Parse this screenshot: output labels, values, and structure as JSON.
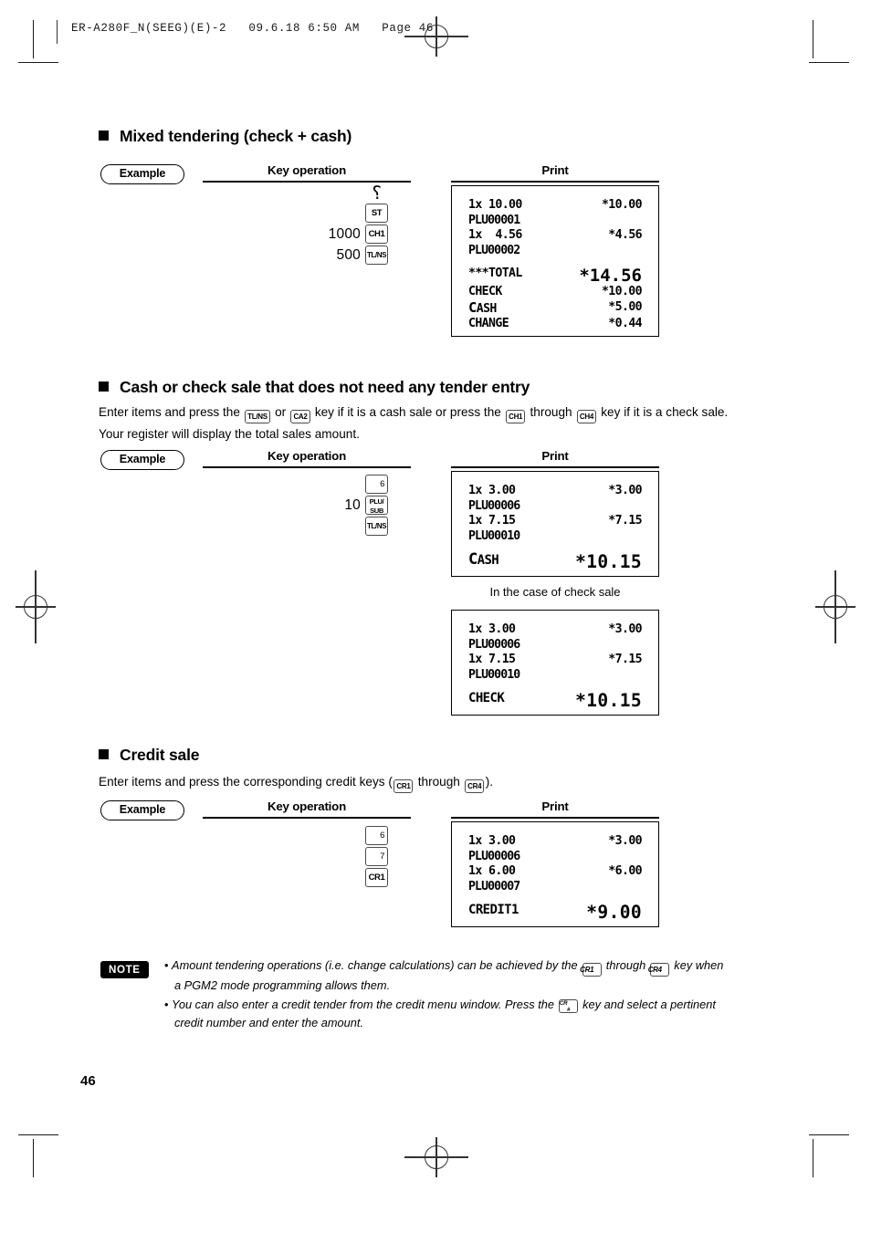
{
  "page": {
    "running_head": "ER-A280F_N(SEEG)(E)-2   09.6.18 6:50 AM   Page 46",
    "page_number": "46"
  },
  "sections": [
    {
      "id": "mixed-tendering",
      "title": "Mixed tendering (check + cash)",
      "example_label": "Example",
      "keyop_header": "Key operation",
      "print_header": "Print",
      "key_operation": {
        "squiggle": "⸮",
        "rows": [
          {
            "amount": "",
            "key": "ST",
            "key_type": "one"
          },
          {
            "amount": "1000",
            "key": "CH1",
            "key_type": "one"
          },
          {
            "amount": "500",
            "key": "TL/NS",
            "key_type": "one"
          }
        ]
      },
      "receipt": {
        "lines": [
          {
            "label": "1x 10.00",
            "value": "*10.00",
            "style": "item"
          },
          {
            "label": "PLU00001",
            "value": "",
            "style": "plu"
          },
          {
            "label": "1x  4.56",
            "value": "*4.56",
            "style": "item"
          },
          {
            "label": "PLU00002",
            "value": "",
            "style": "plu"
          },
          {
            "label": "",
            "value": "",
            "style": "gap"
          },
          {
            "label": "***TOTAL",
            "value": "*14.56",
            "style": "total"
          },
          {
            "label": "CHECK",
            "value": "*10.00",
            "style": "item"
          },
          {
            "label": "CASH",
            "value": "*5.00",
            "style": "item-bigC"
          },
          {
            "label": "CHANGE",
            "value": "*0.44",
            "style": "item"
          }
        ]
      }
    },
    {
      "id": "cash-or-check-no-tender",
      "title": "Cash or check sale that does not need any tender entry",
      "body_parts": [
        {
          "t": "text",
          "v": "Enter items and press the "
        },
        {
          "t": "key",
          "v": "TL/NS"
        },
        {
          "t": "text",
          "v": " or "
        },
        {
          "t": "key",
          "v": "CA2"
        },
        {
          "t": "text",
          "v": " key if it is a cash sale or press the "
        },
        {
          "t": "key",
          "v": "CH1"
        },
        {
          "t": "text",
          "v": " through "
        },
        {
          "t": "key",
          "v": "CH4"
        },
        {
          "t": "text",
          "v": " key if it is a check sale. Your register will display the total sales amount."
        }
      ],
      "example_label": "Example",
      "keyop_header": "Key operation",
      "print_header": "Print",
      "key_operation": {
        "squiggle": "",
        "rows": [
          {
            "amount": "",
            "key": "6",
            "key_type": "num"
          },
          {
            "amount": "10",
            "key": "PLU/SUB",
            "key_type": "two"
          },
          {
            "amount": "",
            "key": "TL/NS",
            "key_type": "one"
          }
        ]
      },
      "receipt": {
        "lines": [
          {
            "label": "1x 3.00",
            "value": "*3.00",
            "style": "item"
          },
          {
            "label": "PLU00006",
            "value": "",
            "style": "plu"
          },
          {
            "label": "1x 7.15",
            "value": "*7.15",
            "style": "item"
          },
          {
            "label": "PLU00010",
            "value": "",
            "style": "plu"
          },
          {
            "label": "",
            "value": "",
            "style": "gap"
          },
          {
            "label": "CASH",
            "value": "*10.15",
            "style": "big-bigC"
          }
        ]
      },
      "caption": "In the case of check sale",
      "receipt2": {
        "lines": [
          {
            "label": "1x 3.00",
            "value": "*3.00",
            "style": "item"
          },
          {
            "label": "PLU00006",
            "value": "",
            "style": "plu"
          },
          {
            "label": "1x 7.15",
            "value": "*7.15",
            "style": "item"
          },
          {
            "label": "PLU00010",
            "value": "",
            "style": "plu"
          },
          {
            "label": "",
            "value": "",
            "style": "gap"
          },
          {
            "label": "CHECK",
            "value": "*10.15",
            "style": "big"
          }
        ]
      }
    },
    {
      "id": "credit-sale",
      "title": "Credit sale",
      "body_parts": [
        {
          "t": "text",
          "v": "Enter items and press the corresponding credit keys ("
        },
        {
          "t": "key",
          "v": "CR1"
        },
        {
          "t": "text",
          "v": " through "
        },
        {
          "t": "key",
          "v": "CR4"
        },
        {
          "t": "text",
          "v": ")."
        }
      ],
      "example_label": "Example",
      "keyop_header": "Key operation",
      "print_header": "Print",
      "key_operation": {
        "squiggle": "",
        "rows": [
          {
            "amount": "",
            "key": "6",
            "key_type": "num"
          },
          {
            "amount": "",
            "key": "7",
            "key_type": "num"
          },
          {
            "amount": "",
            "key": "CR1",
            "key_type": "one"
          }
        ]
      },
      "receipt": {
        "lines": [
          {
            "label": "1x 3.00",
            "value": "*3.00",
            "style": "item"
          },
          {
            "label": "PLU00006",
            "value": "",
            "style": "plu"
          },
          {
            "label": "1x 6.00",
            "value": "*6.00",
            "style": "item"
          },
          {
            "label": "PLU00007",
            "value": "",
            "style": "plu"
          },
          {
            "label": "",
            "value": "",
            "style": "gap"
          },
          {
            "label": "CREDIT1",
            "value": "*9.00",
            "style": "big"
          }
        ]
      }
    }
  ],
  "note": {
    "badge": "NOTE",
    "items": [
      [
        {
          "t": "text",
          "v": "Amount tendering operations (i.e. change calculations) can be achieved by the "
        },
        {
          "t": "key",
          "v": "CR1"
        },
        {
          "t": "text",
          "v": " through "
        },
        {
          "t": "key",
          "v": "CR4"
        },
        {
          "t": "text",
          "v": " key when a PGM2 mode programming allows them."
        }
      ],
      [
        {
          "t": "text",
          "v": "You can also enter a credit tender from the credit menu window. Press the "
        },
        {
          "t": "key2",
          "v": "CR",
          "v2": "#"
        },
        {
          "t": "text",
          "v": " key and select a pertinent credit number and enter the amount."
        }
      ]
    ]
  }
}
